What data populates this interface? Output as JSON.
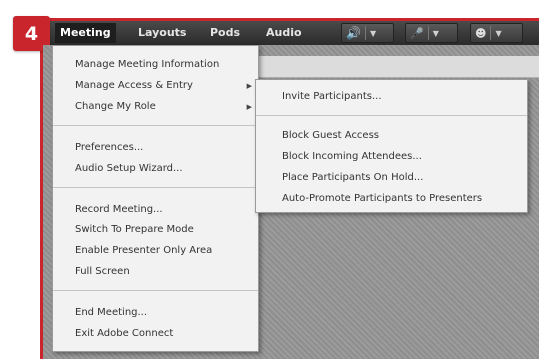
{
  "step_badge": "4",
  "menubar": {
    "items": [
      "Meeting",
      "Layouts",
      "Pods",
      "Audio"
    ]
  },
  "toolbar": {
    "icons": [
      "speaker-icon",
      "microphone-icon",
      "webcam-icon"
    ]
  },
  "meeting_menu": {
    "items": [
      "Manage Meeting Information",
      "Manage Access & Entry",
      "Change My Role",
      "Preferences...",
      "Audio Setup Wizard...",
      "Record Meeting...",
      "Switch To Prepare Mode",
      "Enable Presenter Only Area",
      "Full Screen",
      "End Meeting...",
      "Exit Adobe Connect"
    ]
  },
  "access_submenu": {
    "items": [
      "Invite Participants...",
      "Block Guest Access",
      "Block Incoming Attendees...",
      "Place Participants On Hold...",
      "Auto-Promote Participants to Presenters"
    ]
  },
  "colors": {
    "step_badge": "#c8262c",
    "menubar": "#3a3a3a",
    "menu_background": "#f2f2f2",
    "speaker_active": "#4fd14f"
  }
}
